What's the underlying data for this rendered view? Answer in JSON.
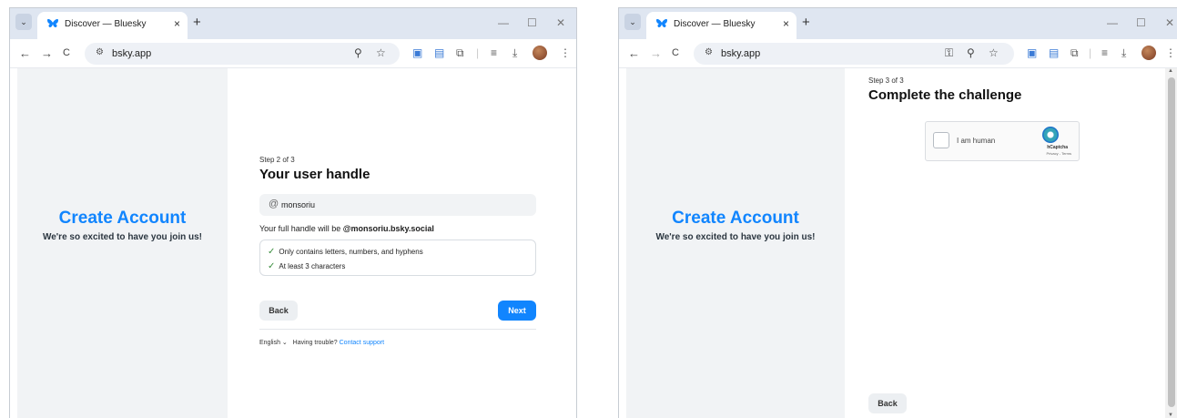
{
  "window1": {
    "tab_title": "Discover — Bluesky",
    "tab_close": "×",
    "new_tab": "+",
    "url": "bsky.app",
    "left_panel": {
      "title": "Create Account",
      "subtitle": "We're so excited to have you join us!"
    },
    "form": {
      "step": "Step 2 of 3",
      "heading": "Your user handle",
      "handle_value": "monsoriu",
      "at_symbol": "@",
      "full_handle_prefix": "Your full handle will be",
      "full_handle": "@monsoriu.bsky.social",
      "checks": [
        "Only contains letters, numbers, and hyphens",
        "At least 3 characters"
      ],
      "back_label": "Back",
      "next_label": "Next"
    },
    "footer": {
      "language": "English",
      "trouble": "Having trouble?",
      "support_link": "Contact support"
    }
  },
  "window2": {
    "tab_title": "Discover — Bluesky",
    "tab_close": "×",
    "new_tab": "+",
    "url": "bsky.app",
    "left_panel": {
      "title": "Create Account",
      "subtitle": "We're so excited to have you join us!"
    },
    "form": {
      "step": "Step 3 of 3",
      "heading": "Complete the challenge",
      "captcha_label": "I am human",
      "captcha_brand": "hCaptcha",
      "captcha_terms": "Privacy - Terms",
      "back_label": "Back"
    }
  },
  "icons": {
    "tab_search": "⌄",
    "back_arrow": "←",
    "forward_arrow": "→",
    "reload": "C",
    "site_settings": "⚙",
    "zoom": "⚲",
    "star": "☆",
    "key": "⚿",
    "check": "✓",
    "chevron": "⌄",
    "minimize": "—",
    "maximize": "☐",
    "close": "✕",
    "menu": "⋮",
    "download": "⤓",
    "puzzle": "⧉",
    "queue": "≡"
  },
  "colors": {
    "accent": "#1185fe",
    "check_green": "#3b8e3f",
    "panel_bg": "#f1f3f5"
  }
}
